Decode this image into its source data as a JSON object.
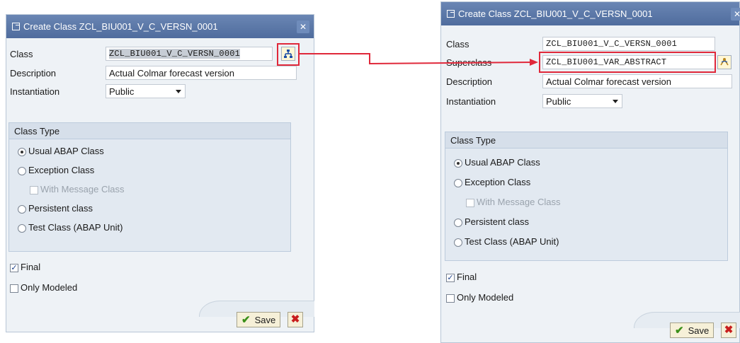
{
  "left_dialog": {
    "title": "Create Class ZCL_BIU001_V_C_VERSN_0001",
    "class_label": "Class",
    "class_value": "ZCL_BIU001_V_C_VERSN_0001",
    "description_label": "Description",
    "description_value": "Actual Colmar forecast version",
    "instantiation_label": "Instantiation",
    "instantiation_value": "Public",
    "class_type": {
      "header": "Class Type",
      "usual": "Usual ABAP Class",
      "exception": "Exception Class",
      "message": "With Message Class",
      "persistent": "Persistent class",
      "test": "Test Class (ABAP Unit)"
    },
    "final_label": "Final",
    "only_modeled_label": "Only Modeled",
    "save_label": "Save",
    "close_glyph": "✕",
    "cancel_glyph": "✖"
  },
  "right_dialog": {
    "title": "Create Class ZCL_BIU001_V_C_VERSN_0001",
    "class_label": "Class",
    "class_value": "ZCL_BIU001_V_C_VERSN_0001",
    "superclass_label": "Superclass",
    "superclass_value": "ZCL_BIU001_VAR_ABSTRACT",
    "description_label": "Description",
    "description_value": "Actual Colmar forecast version",
    "instantiation_label": "Instantiation",
    "instantiation_value": "Public",
    "class_type": {
      "header": "Class Type",
      "usual": "Usual ABAP Class",
      "exception": "Exception Class",
      "message": "With Message Class",
      "persistent": "Persistent class",
      "test": "Test Class (ABAP Unit)"
    },
    "final_label": "Final",
    "only_modeled_label": "Only Modeled",
    "save_label": "Save",
    "close_glyph": "✕",
    "cancel_glyph": "✖"
  },
  "colors": {
    "title_bar": "#5874a6",
    "highlight": "#e0283a",
    "dialog_bg": "#eef2f6",
    "group_bg": "#e2e9f1"
  },
  "icons": {
    "inherit_button": "inheritance-icon",
    "undo_inherit_button": "undo-inheritance-icon",
    "arrow": "red-arrow-annotation"
  }
}
